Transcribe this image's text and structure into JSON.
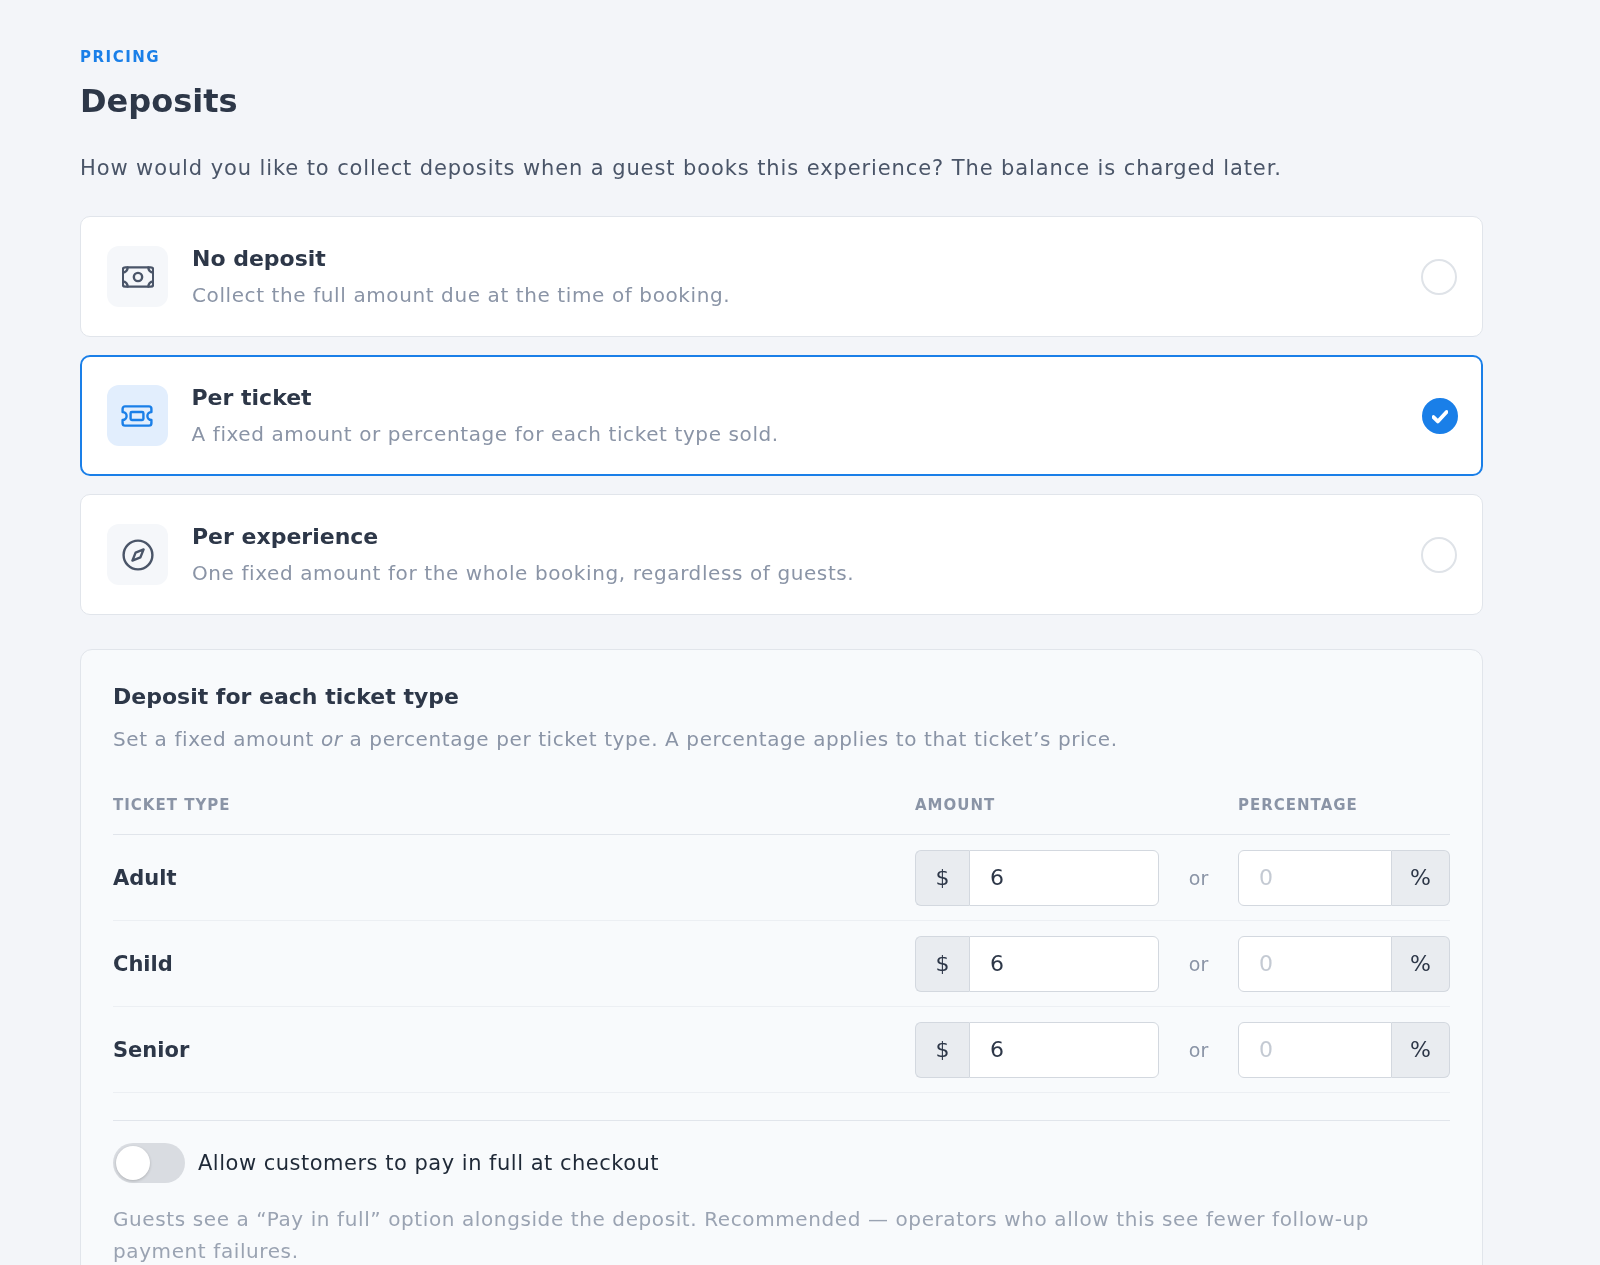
{
  "header": {
    "eyebrow": "PRICING",
    "title": "Deposits",
    "description": "How would you like to collect deposits when a guest books this experience? The balance is charged later."
  },
  "options": [
    {
      "kind": "cash",
      "title": "No deposit",
      "description": "Collect the full amount due at the time of booking.",
      "selected": false
    },
    {
      "kind": "ticket",
      "title": "Per ticket",
      "description": "A fixed amount or percentage for each ticket type sold.",
      "selected": true
    },
    {
      "kind": "compass",
      "title": "Per experience",
      "description": "One fixed amount for the whole booking, regardless of guests.",
      "selected": false
    }
  ],
  "ticket_deposits": {
    "title": "Deposit for each ticket type",
    "description": "Set a fixed amount *or* a percentage per ticket type. A percentage applies to that ticket’s price.",
    "columns": [
      "TICKET TYPE",
      "AMOUNT",
      "PERCENTAGE"
    ],
    "rows": [
      {
        "ticket_type": "Adult",
        "currency": "$",
        "amount": "6",
        "separator": "or",
        "percentage": {
          "placeholder": "0"
        },
        "unit": "%"
      },
      {
        "ticket_type": "Child",
        "currency": "$",
        "amount": "6",
        "separator": "or",
        "percentage": {
          "placeholder": "0"
        },
        "unit": "%"
      },
      {
        "ticket_type": "Senior",
        "currency": "$",
        "amount": "6",
        "separator": "or",
        "percentage": {
          "placeholder": "0"
        },
        "unit": "%"
      }
    ]
  },
  "pay_in_full": {
    "label": "Allow customers to pay in full at checkout",
    "on": false,
    "note": "Guests see a “Pay in full” option alongside the deposit. Recommended — operators who allow this see fewer follow-up payment failures."
  }
}
